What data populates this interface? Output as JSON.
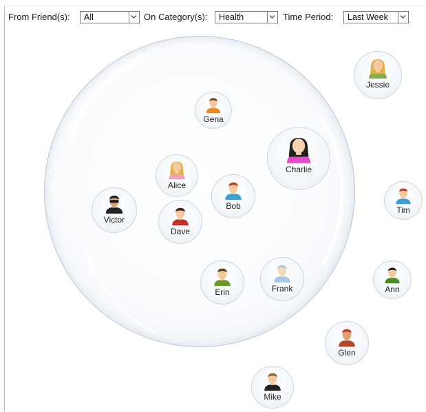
{
  "toolbar": {
    "from_friends_label": "From Friend(s):",
    "from_friends_value": "All",
    "category_label": "On Category(s):",
    "category_value": "Health",
    "time_period_label": "Time Period:",
    "time_period_value": "Last Week"
  },
  "friends": [
    {
      "name": "Jessie"
    },
    {
      "name": "Gena"
    },
    {
      "name": "Charlie"
    },
    {
      "name": "Alice"
    },
    {
      "name": "Bob"
    },
    {
      "name": "Victor"
    },
    {
      "name": "Dave"
    },
    {
      "name": "Tim"
    },
    {
      "name": "Erin"
    },
    {
      "name": "Frank"
    },
    {
      "name": "Ann"
    },
    {
      "name": "Glen"
    },
    {
      "name": "Mike"
    }
  ],
  "colors": {
    "bubble_border": "#b9c6d3",
    "node_border": "#c9d6e3",
    "dropdown_border": "#7a7a7a"
  },
  "icons": [
    "chevron-down-icon",
    "person-avatar-icon"
  ]
}
